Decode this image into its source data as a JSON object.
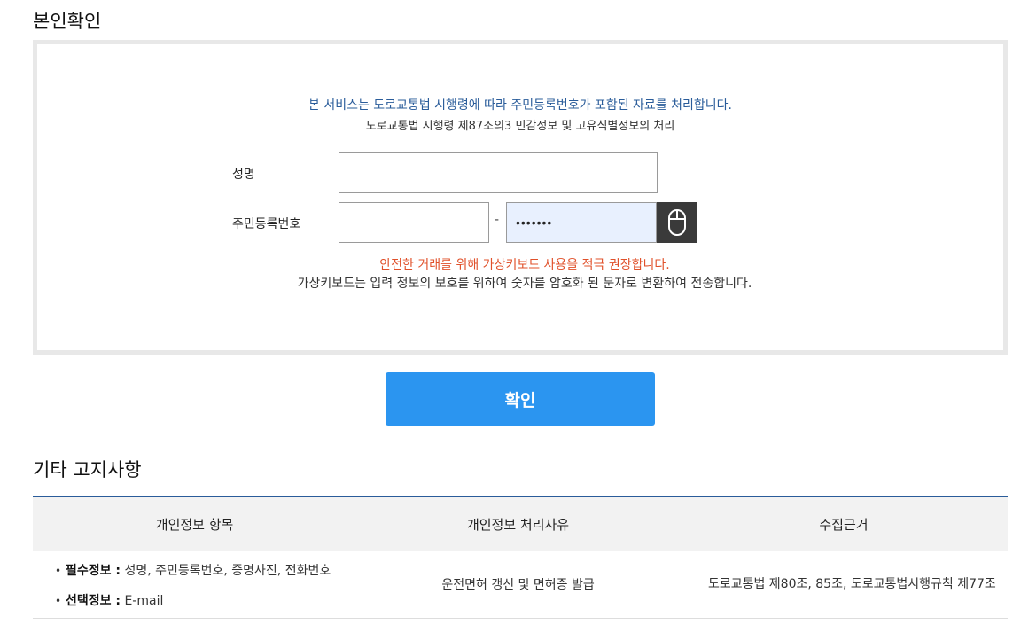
{
  "identity_section": {
    "title": "본인확인",
    "notice_blue": "본 서비스는 도로교통법 시행령에 따라 주민등록번호가 포함된 자료를 처리합니다.",
    "notice_law": "도로교통법 시행령 제87조의3 민감정보 및 고유식별정보의 처리",
    "name_label": "성명",
    "name_value": "",
    "rrn_label": "주민등록번호",
    "rrn_front_value": "",
    "rrn_separator": "-",
    "rrn_back_value": "•••••••",
    "virtual_keyboard_icon": "mouse-icon",
    "warning_red": "안전한 거래를 위해 가상키보드 사용을 적극 권장합니다.",
    "warning_info": "가상키보드는 입력 정보의 보호를 위하여 숫자를 암호화 된 문자로 변환하여 전송합니다."
  },
  "confirm_button_label": "확인",
  "other_notice": {
    "title": "기타 고지사항",
    "headers": [
      "개인정보 항목",
      "개인정보 처리사유",
      "수집근거"
    ],
    "row": {
      "required_label": "필수정보 :",
      "required_items": " 성명, 주민등록번호, 증명사진, 전화번호",
      "optional_label": "선택정보 :",
      "optional_items": " E-mail",
      "reason": "운전면허 갱신 및 면허증 발급",
      "basis": "도로교통법 제80조, 85조, 도로교통법시행규칙 제77조"
    }
  },
  "colors": {
    "accent_blue": "#2b95f0",
    "notice_blue": "#2a5c9a",
    "warning_red": "#e0502a"
  }
}
